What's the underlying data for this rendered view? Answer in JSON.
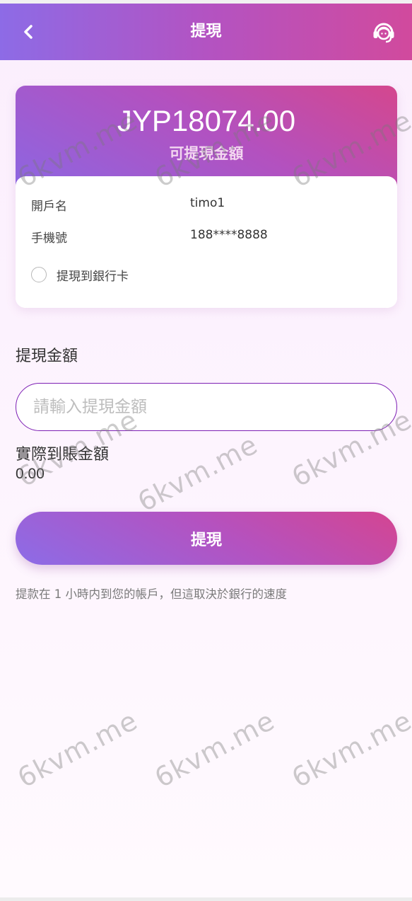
{
  "header": {
    "title": "提現",
    "back_icon": "chevron-left-icon",
    "service_icon": "customer-service-icon"
  },
  "balance": {
    "amount": "JYP18074.00",
    "caption": "可提現金額"
  },
  "account": {
    "name_label": "開戶名",
    "name_value": "timo1",
    "phone_label": "手機號",
    "phone_value": "188****8888",
    "bank_option_label": "提現到銀行卡"
  },
  "form": {
    "amount_label": "提現金額",
    "amount_placeholder": "請輸入提現金額",
    "actual_label": "實際到賬金額",
    "actual_value": "0.00",
    "submit_label": "提現",
    "notice": "提款在 1 小時内到您的帳戶，但這取決於銀行的速度"
  },
  "watermark": {
    "text": "6kvm.me"
  },
  "colors": {
    "gradient_start": "#8d6be6",
    "gradient_end": "#d14a9d",
    "input_border": "#7d1fb4"
  }
}
